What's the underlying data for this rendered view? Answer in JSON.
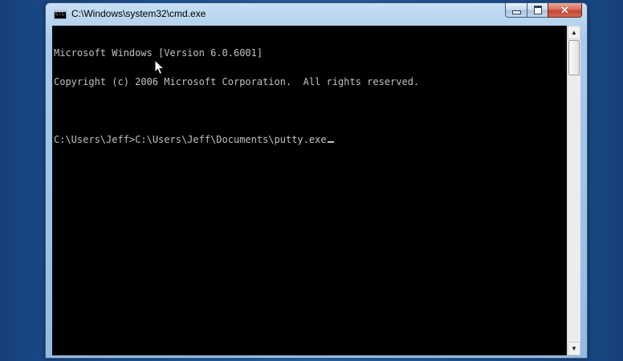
{
  "window": {
    "title": "C:\\Windows\\system32\\cmd.exe",
    "icon_name": "console-app-icon",
    "icon_text": "C:\\"
  },
  "controls": {
    "minimize": "minimize-icon",
    "maximize": "maximize-icon",
    "close": "close-icon",
    "close_glyph": "✕"
  },
  "console": {
    "lines": [
      "Microsoft Windows [Version 6.0.6001]",
      "Copyright (c) 2006 Microsoft Corporation.  All rights reserved.",
      "",
      "C:\\Users\\Jeff>C:\\Users\\Jeff\\Documents\\putty.exe"
    ],
    "foreground": "#c0c0c0",
    "background": "#000000"
  },
  "scrollbar": {
    "up_glyph": "▲",
    "down_glyph": "▼"
  }
}
